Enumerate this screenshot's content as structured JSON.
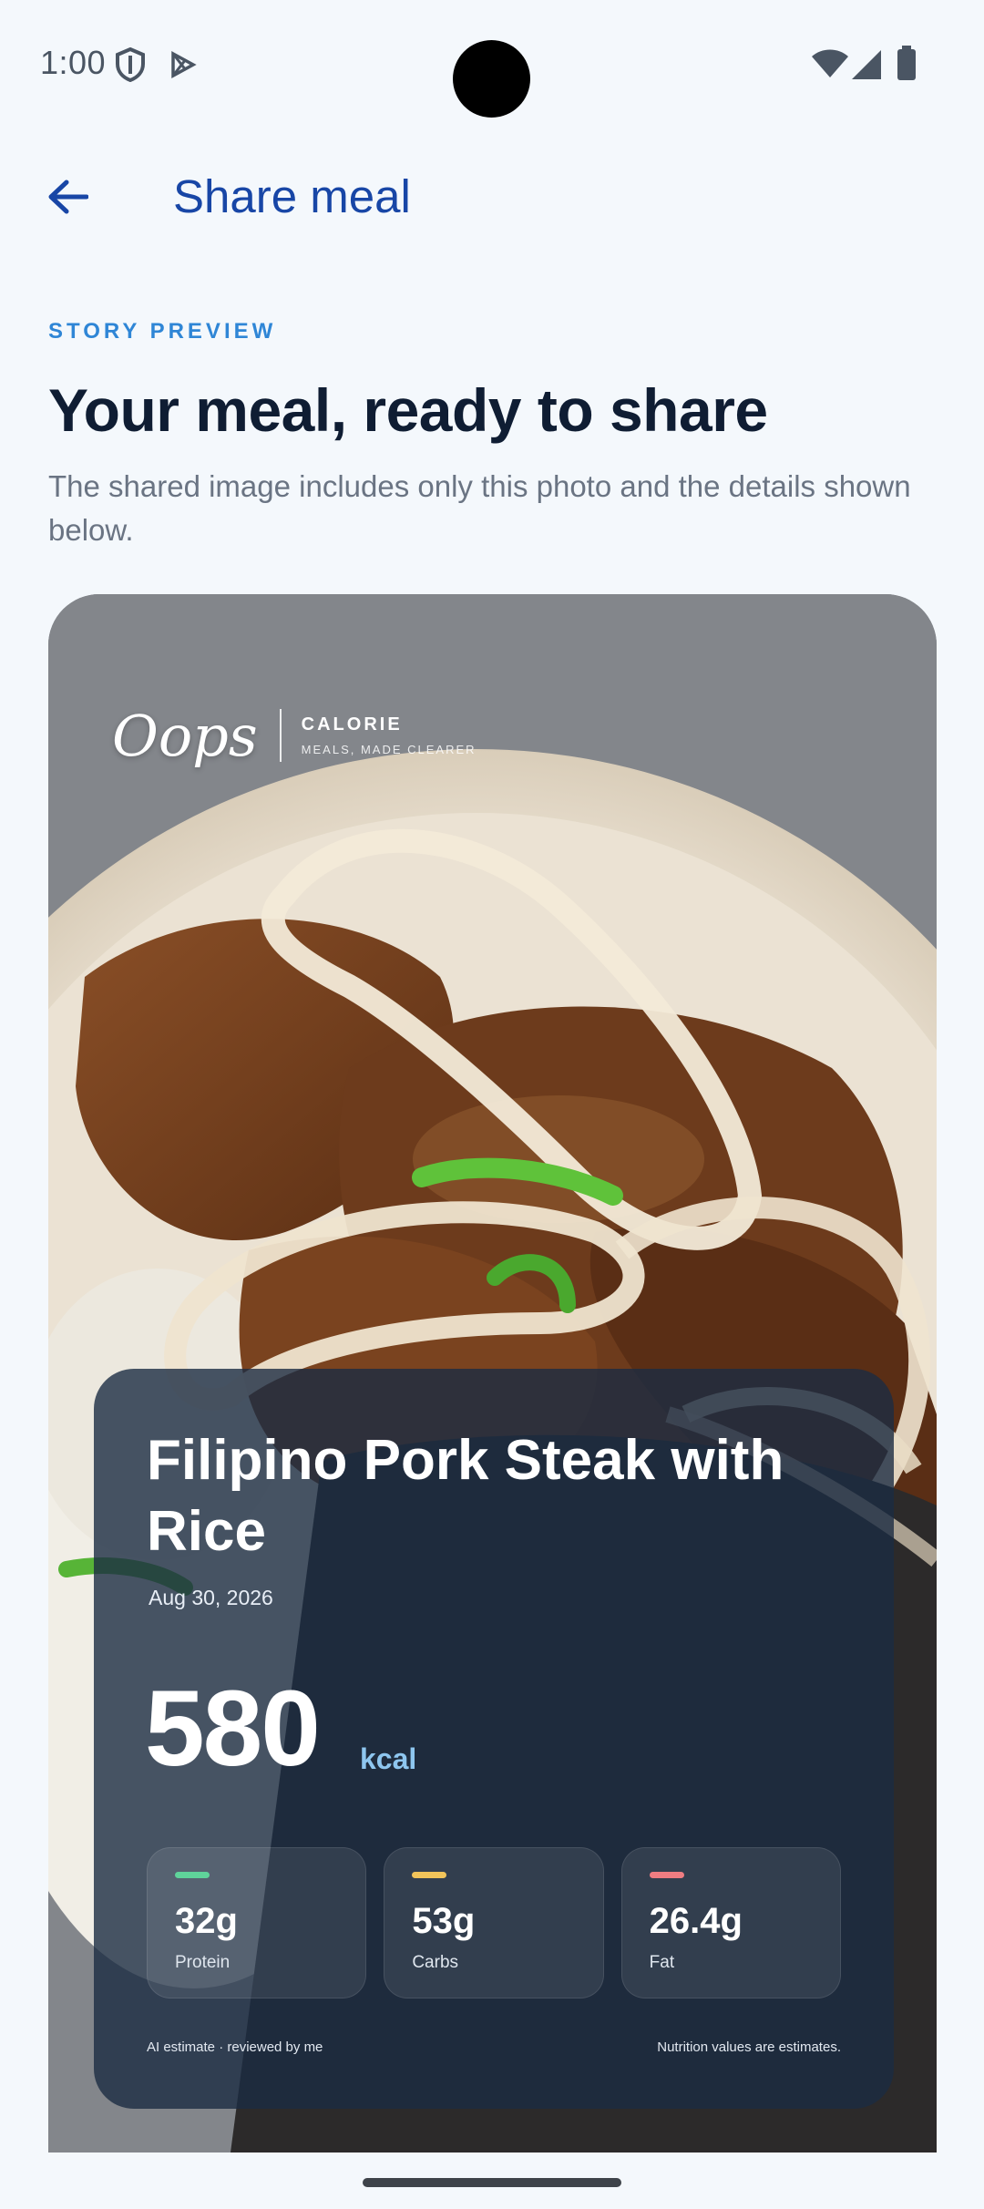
{
  "status_bar": {
    "time": "1:00",
    "left_icons": [
      "shield-icon",
      "play-store-icon"
    ],
    "right_icons": [
      "wifi-icon",
      "cellular-signal-icon",
      "battery-icon"
    ]
  },
  "app_bar": {
    "back_icon": "arrow-left-icon",
    "title": "Share meal"
  },
  "header": {
    "overline": "STORY PREVIEW",
    "headline": "Your meal, ready to share",
    "subtext": "The shared image includes only this photo and the details shown below."
  },
  "story_card": {
    "brand": {
      "script": "Oops",
      "name": "CALORIE",
      "tagline": "MEALS, MADE CLEARER"
    },
    "meal": {
      "name": "Filipino Pork Steak with Rice",
      "date": "Aug 30, 2026",
      "calories": "580",
      "calories_unit": "kcal"
    },
    "macros": [
      {
        "value": "32g",
        "label": "Protein",
        "color": "#5fd39a"
      },
      {
        "value": "53g",
        "label": "Carbs",
        "color": "#f2c45a"
      },
      {
        "value": "26.4g",
        "label": "Fat",
        "color": "#ef7d82"
      }
    ],
    "footer_left": "AI estimate · reviewed by me",
    "footer_right": "Nutrition values are estimates."
  },
  "colors": {
    "accent": "#1846a6",
    "overline": "#2f86d6",
    "background": "#f4f8fc",
    "panel": "#1c2c42"
  }
}
